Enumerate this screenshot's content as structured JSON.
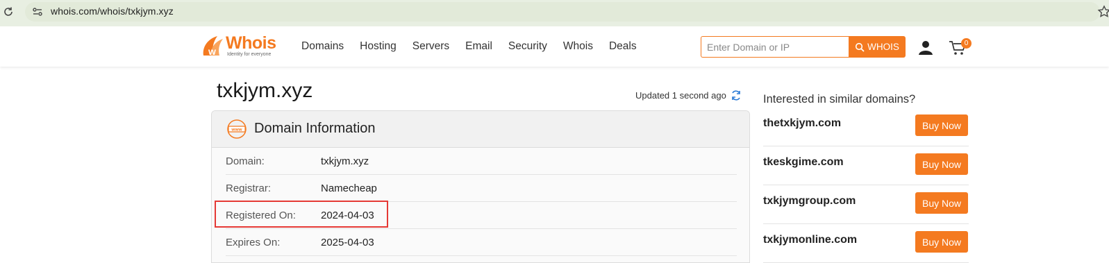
{
  "browser": {
    "url": "whois.com/whois/txkjym.xyz"
  },
  "header": {
    "logo_text": "Whois",
    "logo_tagline": "Identity for everyone",
    "nav": [
      "Domains",
      "Hosting",
      "Servers",
      "Email",
      "Security",
      "Whois",
      "Deals"
    ],
    "search_placeholder": "Enter Domain or IP",
    "search_button": "WHOIS",
    "cart_count": "0"
  },
  "main": {
    "domain_title": "txkjym.xyz",
    "updated_text": "Updated 1 second ago",
    "panel_title": "Domain Information",
    "rows": [
      {
        "label": "Domain:",
        "value": "txkjym.xyz"
      },
      {
        "label": "Registrar:",
        "value": "Namecheap"
      },
      {
        "label": "Registered On:",
        "value": "2024-04-03"
      },
      {
        "label": "Expires On:",
        "value": "2025-04-03"
      }
    ]
  },
  "sidebar": {
    "title": "Interested in similar domains?",
    "buy_label": "Buy Now",
    "suggestions": [
      "thetxkjym.com",
      "tkeskgime.com",
      "txkjymgroup.com",
      "txkjymonline.com"
    ]
  },
  "colors": {
    "accent": "#f47a20",
    "highlight": "#e53935"
  }
}
